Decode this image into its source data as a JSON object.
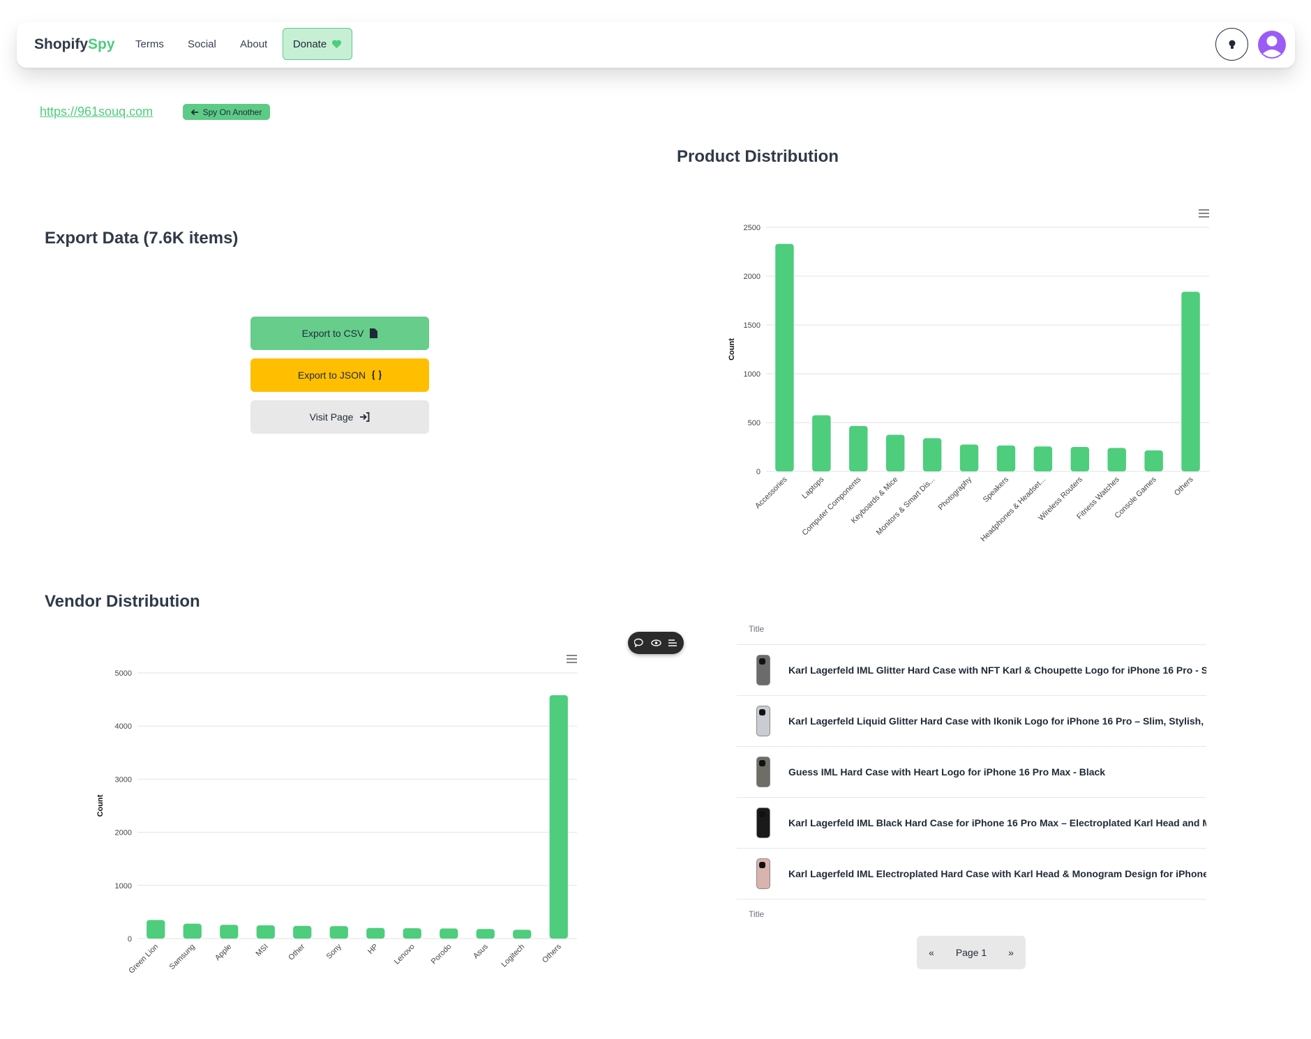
{
  "nav": {
    "brand_part1": "Shopify",
    "brand_part2": "Spy",
    "links": [
      "Terms",
      "Social",
      "About"
    ],
    "donate_label": "Donate",
    "theme_icon": "lightbulb-icon",
    "avatar_icon": "user-avatar-icon"
  },
  "site": {
    "url": "https://961souq.com",
    "spy_another_label": "Spy On Another"
  },
  "export": {
    "title": "Export Data (7.6K items)",
    "csv_label": "Export to CSV",
    "json_label": "Export to JSON",
    "visit_label": "Visit Page"
  },
  "product_section_title": "Product Distribution",
  "vendor_section_title": "Vendor Distribution",
  "chart_data": [
    {
      "type": "bar",
      "categories": [
        "Accessories",
        "Laptops",
        "Computer Components",
        "Keyboards & Mice",
        "Monitors & Smart Dis...",
        "Photography",
        "Speakers",
        "Headphones & Headset...",
        "Wireless Routers",
        "Fitness Watches",
        "Console Games",
        "Others"
      ],
      "values": [
        2330,
        575,
        465,
        375,
        340,
        275,
        265,
        255,
        250,
        240,
        215,
        1840
      ],
      "ylabel": "Count",
      "ylim": [
        0,
        2500
      ],
      "yticks": [
        0,
        500,
        1000,
        1500,
        2000,
        2500
      ],
      "color": "#4ecd7d",
      "grid": true
    },
    {
      "type": "bar",
      "categories": [
        "Green Lion",
        "Samsung",
        "Apple",
        "MSI",
        "Other",
        "Sony",
        "HP",
        "Lenovo",
        "Porodo",
        "Asus",
        "Logitech",
        "Others"
      ],
      "values": [
        350,
        280,
        260,
        250,
        240,
        235,
        200,
        195,
        190,
        180,
        165,
        4580
      ],
      "ylabel": "Count",
      "ylim": [
        0,
        5000
      ],
      "yticks": [
        0,
        1000,
        2000,
        3000,
        4000,
        5000
      ],
      "color": "#4ecd7d",
      "grid": true
    }
  ],
  "table": {
    "header": "Title",
    "footer": "Title",
    "rows": [
      {
        "title": "Karl Lagerfeld IML Glitter Hard Case with NFT Karl & Choupette Logo for iPhone 16 Pro - S",
        "thumb": "#6b6b6b"
      },
      {
        "title": "Karl Lagerfeld Liquid Glitter Hard Case with Ikonik Logo for iPhone 16 Pro – Slim, Stylish, a",
        "thumb": "#c9cdd3"
      },
      {
        "title": "Guess IML Hard Case with Heart Logo for iPhone 16 Pro Max - Black",
        "thumb": "#6e6e66"
      },
      {
        "title": "Karl Lagerfeld IML Black Hard Case for iPhone 16 Pro Max – Electroplated Karl Head and M",
        "thumb": "#1a1a1a"
      },
      {
        "title": "Karl Lagerfeld IML Electroplated Hard Case with Karl Head & Monogram Design for iPhone",
        "thumb": "#d9b3ad"
      }
    ]
  },
  "pagination": {
    "prev": "«",
    "page_label": "Page 1",
    "next": "»"
  }
}
